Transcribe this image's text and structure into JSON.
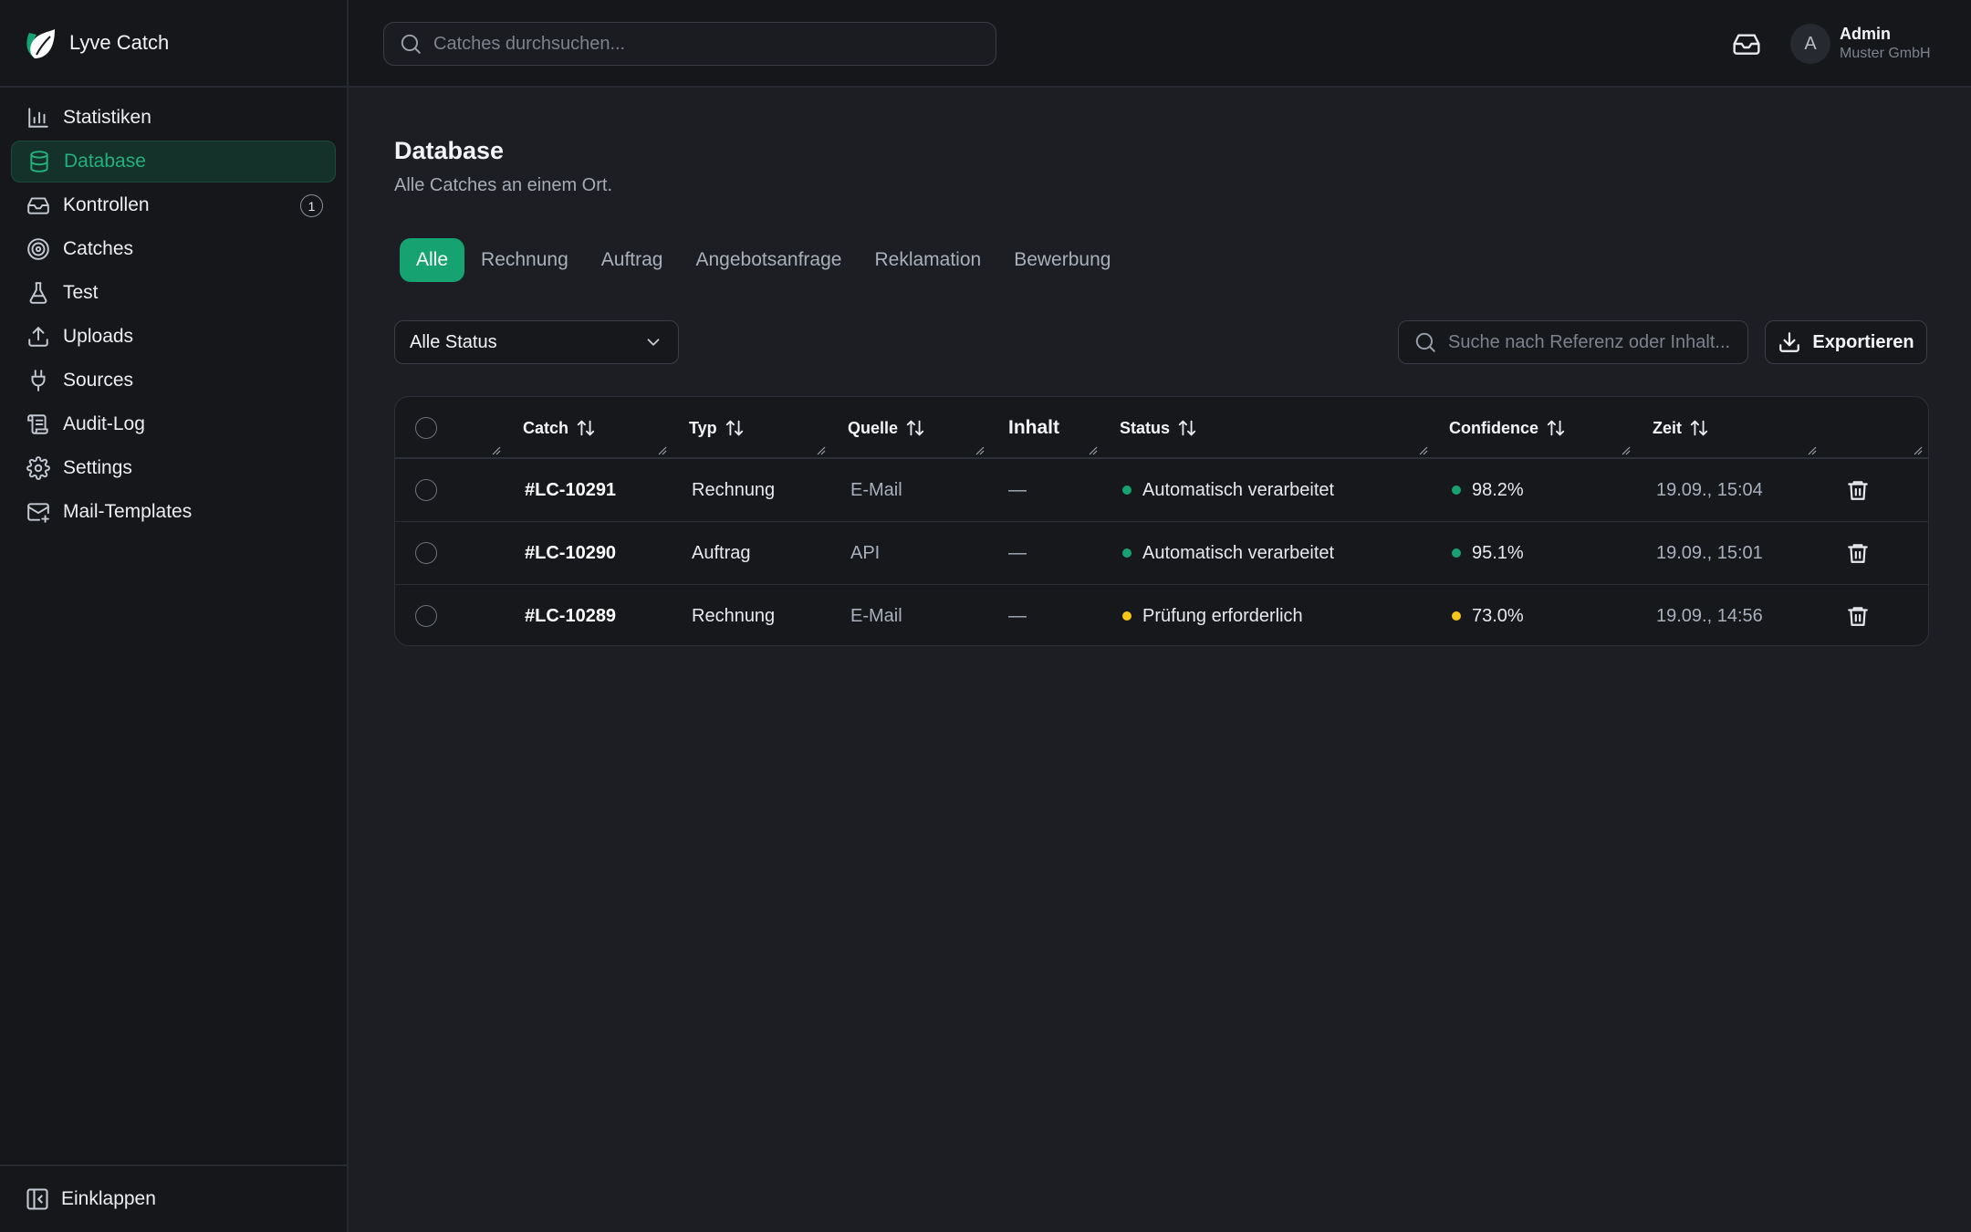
{
  "app": {
    "name": "Lyve Catch"
  },
  "colors": {
    "accent": "#16a371",
    "success": "#16a371",
    "warning": "#f5c518"
  },
  "sidebar": {
    "items": [
      {
        "label": "Statistiken",
        "icon": "bar-chart-icon"
      },
      {
        "label": "Database",
        "icon": "database-icon",
        "active": true
      },
      {
        "label": "Kontrollen",
        "icon": "inbox-icon",
        "badge": "1"
      },
      {
        "label": "Catches",
        "icon": "target-icon"
      },
      {
        "label": "Test",
        "icon": "flask-icon"
      },
      {
        "label": "Uploads",
        "icon": "upload-icon"
      },
      {
        "label": "Sources",
        "icon": "plug-icon"
      },
      {
        "label": "Audit-Log",
        "icon": "scroll-icon"
      },
      {
        "label": "Settings",
        "icon": "gear-icon"
      },
      {
        "label": "Mail-Templates",
        "icon": "mail-plus-icon"
      }
    ],
    "collapse_label": "Einklappen"
  },
  "topbar": {
    "search_placeholder": "Catches durchsuchen...",
    "avatar_initial": "A",
    "user_name": "Admin",
    "user_org": "Muster GmbH"
  },
  "page": {
    "title": "Database",
    "subtitle": "Alle Catches an einem Ort."
  },
  "tabs": [
    {
      "label": "Alle",
      "active": true
    },
    {
      "label": "Rechnung"
    },
    {
      "label": "Auftrag"
    },
    {
      "label": "Angebotsanfrage"
    },
    {
      "label": "Reklamation"
    },
    {
      "label": "Bewerbung"
    }
  ],
  "filters": {
    "status_value": "Alle Status",
    "search_placeholder": "Suche nach Referenz oder Inhalt...",
    "export_label": "Exportieren"
  },
  "table": {
    "columns": [
      {
        "label": "Catch",
        "sortable": true
      },
      {
        "label": "Typ",
        "sortable": true
      },
      {
        "label": "Quelle",
        "sortable": true
      },
      {
        "label": "Inhalt",
        "sortable": false
      },
      {
        "label": "Status",
        "sortable": true
      },
      {
        "label": "Confidence",
        "sortable": true
      },
      {
        "label": "Zeit",
        "sortable": true
      }
    ],
    "rows": [
      {
        "ref": "#LC-10291",
        "type": "Rechnung",
        "source": "E-Mail",
        "content": "—",
        "status": "Automatisch verarbeitet",
        "status_color": "#16a371",
        "confidence": "98.2%",
        "confidence_color": "#16a371",
        "time": "19.09., 15:04"
      },
      {
        "ref": "#LC-10290",
        "type": "Auftrag",
        "source": "API",
        "content": "—",
        "status": "Automatisch verarbeitet",
        "status_color": "#16a371",
        "confidence": "95.1%",
        "confidence_color": "#16a371",
        "time": "19.09., 15:01"
      },
      {
        "ref": "#LC-10289",
        "type": "Rechnung",
        "source": "E-Mail",
        "content": "—",
        "status": "Prüfung erforderlich",
        "status_color": "#f5c518",
        "confidence": "73.0%",
        "confidence_color": "#f5c518",
        "time": "19.09., 14:56"
      }
    ]
  }
}
